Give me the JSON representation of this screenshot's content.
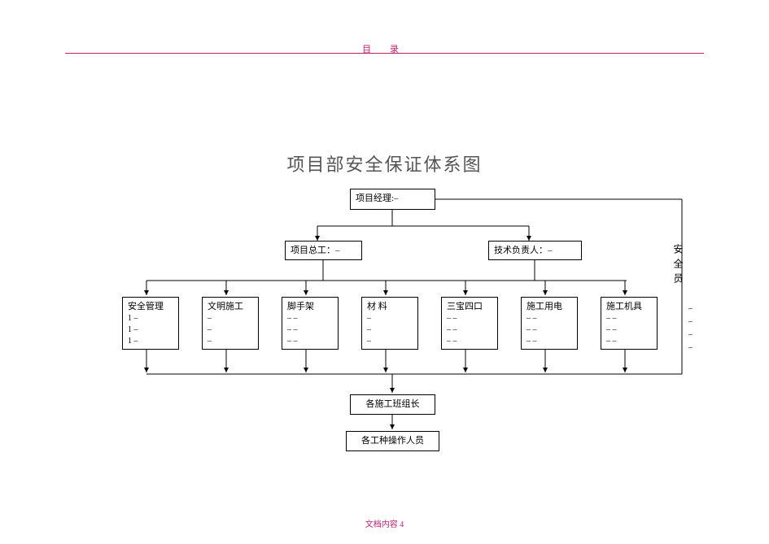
{
  "header": {
    "label": "目    录"
  },
  "title": "项目部安全保证体系图",
  "nodes": {
    "manager": {
      "label": "项目经理:–"
    },
    "chief": {
      "label": "项目总工：–"
    },
    "tech": {
      "label": "技术负责人：–"
    },
    "safety_officer": {
      "label": "安全员"
    },
    "safety_officer_dashes": [
      "–",
      "–",
      "–",
      "–"
    ],
    "teamlead": {
      "label": "各施工班组长"
    },
    "operators": {
      "label": "各工种操作人员"
    }
  },
  "dept_boxes": [
    {
      "title": "安全管理",
      "rows": [
        "1    –",
        "1    –",
        "1    –"
      ]
    },
    {
      "title": "文明施工",
      "rows": [
        "–",
        "–",
        "–"
      ]
    },
    {
      "title": "脚手架",
      "rows": [
        "–    –",
        "–    –",
        "–    –"
      ]
    },
    {
      "title": "材    料",
      "rows": [
        "–",
        "–",
        "–"
      ]
    },
    {
      "title": "三宝四口",
      "rows": [
        "–    –",
        "–    –",
        "–    –"
      ]
    },
    {
      "title": "施工用电",
      "rows": [
        "–    –",
        "–    –",
        "–    –"
      ]
    },
    {
      "title": "施工机具",
      "rows": [
        "–    –",
        "–    –",
        "–    –"
      ]
    }
  ],
  "footer": {
    "text": "文档内容",
    "page": "4"
  },
  "chart_data": {
    "type": "table",
    "description": "Organizational hierarchy flowchart (safety assurance system)",
    "hierarchy": {
      "项目经理": {
        "children": [
          "项目总工",
          "技术负责人",
          "安全员"
        ],
        "项目总工": {
          "children_group": "departments"
        },
        "技术负责人": {
          "children_group": "departments"
        },
        "departments": [
          "安全管理",
          "文明施工",
          "脚手架",
          "材料",
          "三宝四口",
          "施工用电",
          "施工机具"
        ],
        "departments_child": "各施工班组长",
        "各施工班组长_child": "各工种操作人员",
        "安全员_child": "各施工班组长"
      }
    }
  }
}
